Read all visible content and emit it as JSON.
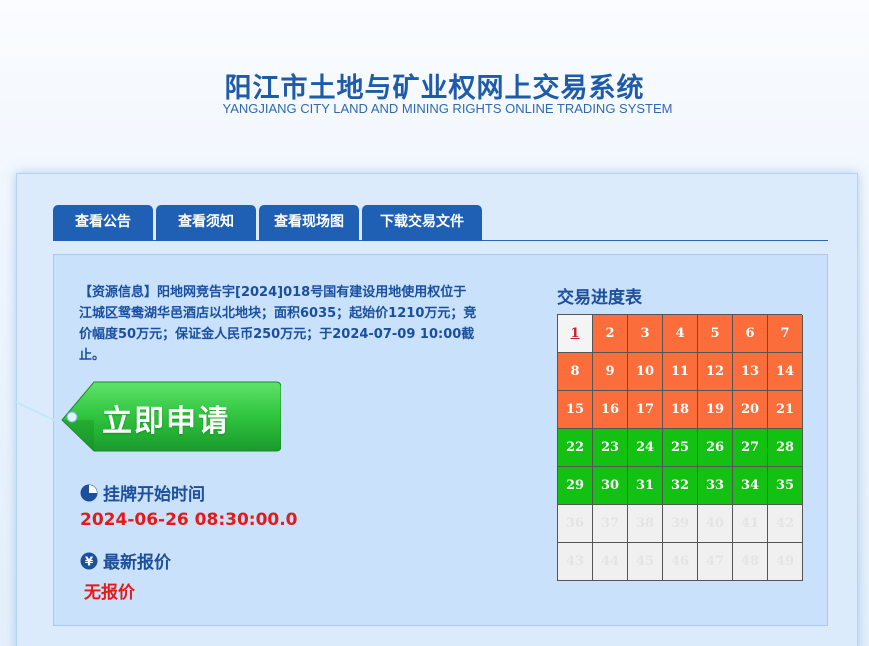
{
  "header": {
    "title": "阳江市土地与矿业权网上交易系统",
    "subtitle": "YANGJIANG CITY LAND AND MINING RIGHTS ONLINE TRADING SYSTEM"
  },
  "tabs": [
    {
      "label": "查看公告"
    },
    {
      "label": "查看须知"
    },
    {
      "label": "查看现场图"
    },
    {
      "label": "下载交易文件"
    }
  ],
  "resource": {
    "text": "【资源信息】阳地网竞告宇[2024]018号国有建设用地使用权位于江城区鸳鸯湖华邑酒店以北地块；面积6035；起始价1210万元；竞价幅度50万元；保证金人民币250万元；于2024-07-09 10:00截止。"
  },
  "apply_button": {
    "label": "立即申请"
  },
  "listing": {
    "title": "挂牌开始时间",
    "value": "2024-06-26 08:30:00.0",
    "icon": "clock-icon"
  },
  "latest_price": {
    "title": "最新报价",
    "value": "无报价",
    "icon": "yen-icon"
  },
  "progress": {
    "title": "交易进度表",
    "current_day": 1,
    "cells": [
      {
        "label": "1",
        "status": "current"
      },
      {
        "label": "2",
        "status": "orange"
      },
      {
        "label": "3",
        "status": "orange"
      },
      {
        "label": "4",
        "status": "orange"
      },
      {
        "label": "5",
        "status": "orange"
      },
      {
        "label": "6",
        "status": "orange"
      },
      {
        "label": "7",
        "status": "orange"
      },
      {
        "label": "8",
        "status": "orange"
      },
      {
        "label": "9",
        "status": "orange"
      },
      {
        "label": "10",
        "status": "orange"
      },
      {
        "label": "11",
        "status": "orange"
      },
      {
        "label": "12",
        "status": "orange"
      },
      {
        "label": "13",
        "status": "orange"
      },
      {
        "label": "14",
        "status": "orange"
      },
      {
        "label": "15",
        "status": "orange"
      },
      {
        "label": "16",
        "status": "orange"
      },
      {
        "label": "17",
        "status": "orange"
      },
      {
        "label": "18",
        "status": "orange"
      },
      {
        "label": "19",
        "status": "orange"
      },
      {
        "label": "20",
        "status": "orange"
      },
      {
        "label": "21",
        "status": "orange"
      },
      {
        "label": "22",
        "status": "green"
      },
      {
        "label": "23",
        "status": "green"
      },
      {
        "label": "24",
        "status": "green"
      },
      {
        "label": "25",
        "status": "green"
      },
      {
        "label": "26",
        "status": "green"
      },
      {
        "label": "27",
        "status": "green"
      },
      {
        "label": "28",
        "status": "green"
      },
      {
        "label": "29",
        "status": "green"
      },
      {
        "label": "30",
        "status": "green"
      },
      {
        "label": "31",
        "status": "green"
      },
      {
        "label": "32",
        "status": "green"
      },
      {
        "label": "33",
        "status": "green"
      },
      {
        "label": "34",
        "status": "green"
      },
      {
        "label": "35",
        "status": "green"
      },
      {
        "label": "36",
        "status": "future"
      },
      {
        "label": "37",
        "status": "future"
      },
      {
        "label": "38",
        "status": "future"
      },
      {
        "label": "39",
        "status": "future"
      },
      {
        "label": "40",
        "status": "future"
      },
      {
        "label": "41",
        "status": "future"
      },
      {
        "label": "42",
        "status": "future"
      },
      {
        "label": "43",
        "status": "future"
      },
      {
        "label": "44",
        "status": "future"
      },
      {
        "label": "45",
        "status": "future"
      },
      {
        "label": "46",
        "status": "future"
      },
      {
        "label": "47",
        "status": "future"
      },
      {
        "label": "48",
        "status": "future"
      },
      {
        "label": "49",
        "status": "future"
      }
    ]
  },
  "colors": {
    "primary": "#1f5fb4",
    "orange": "#fb6e3b",
    "green": "#12c112",
    "alert_red": "#e41a1a"
  }
}
